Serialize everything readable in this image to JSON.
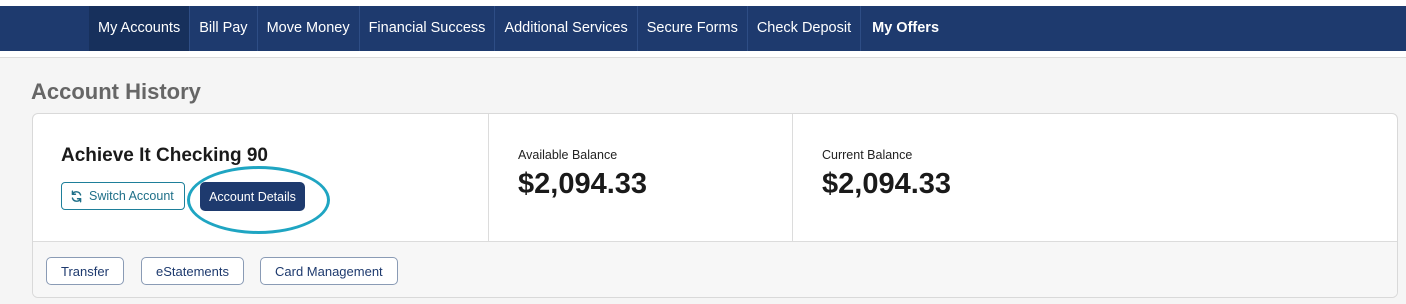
{
  "nav": {
    "items": [
      {
        "label": "My Accounts"
      },
      {
        "label": "Bill Pay"
      },
      {
        "label": "Move Money"
      },
      {
        "label": "Financial Success"
      },
      {
        "label": "Additional Services"
      },
      {
        "label": "Secure Forms"
      },
      {
        "label": "Check Deposit"
      },
      {
        "label": "My Offers"
      }
    ]
  },
  "page": {
    "title": "Account History"
  },
  "account": {
    "name": "Achieve It Checking 90",
    "switch_label": "Switch Account",
    "details_label": "Account Details",
    "available": {
      "label": "Available Balance",
      "value": "$2,094.33"
    },
    "current": {
      "label": "Current Balance",
      "value": "$2,094.33"
    }
  },
  "actions": {
    "transfer": "Transfer",
    "estatements": "eStatements",
    "card_management": "Card Management"
  },
  "colors": {
    "nav_bg": "#1e3a6e",
    "accent": "#1fa5c2",
    "primary_button": "#1e3a6e"
  },
  "icons": {
    "switch": "refresh-icon"
  }
}
